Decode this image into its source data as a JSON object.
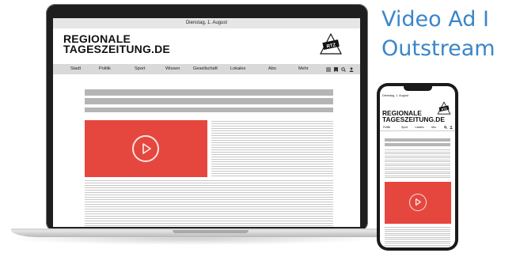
{
  "headline": {
    "line1": "Video Ad I",
    "line2": "Outstream"
  },
  "laptop_page": {
    "date": "Dienstag, 1. August",
    "brand_line1": "REGIONALE",
    "brand_line2": "TAGESZEITUNG.DE",
    "logo_text": "RTZ",
    "nav": [
      "Stadt",
      "Politik",
      "Sport",
      "Wissen",
      "Gesellschaft",
      "Lokales",
      "Abo",
      "Mehr"
    ],
    "nav_icons": [
      "menu-icon",
      "bookmark-icon",
      "search-icon",
      "user-icon"
    ]
  },
  "phone_page": {
    "date": "Dienstag, 1. August",
    "brand_line1": "REGIONALE",
    "brand_line2": "TAGESZEITUNG.DE",
    "logo_text": "RTZ",
    "nav": [
      "Politik",
      "Sport",
      "Lokales",
      "Abo"
    ]
  },
  "colors": {
    "accent_text": "#3a86c9",
    "video_red": "#e5473e",
    "placeholder_grey": "#b5b5b5"
  }
}
